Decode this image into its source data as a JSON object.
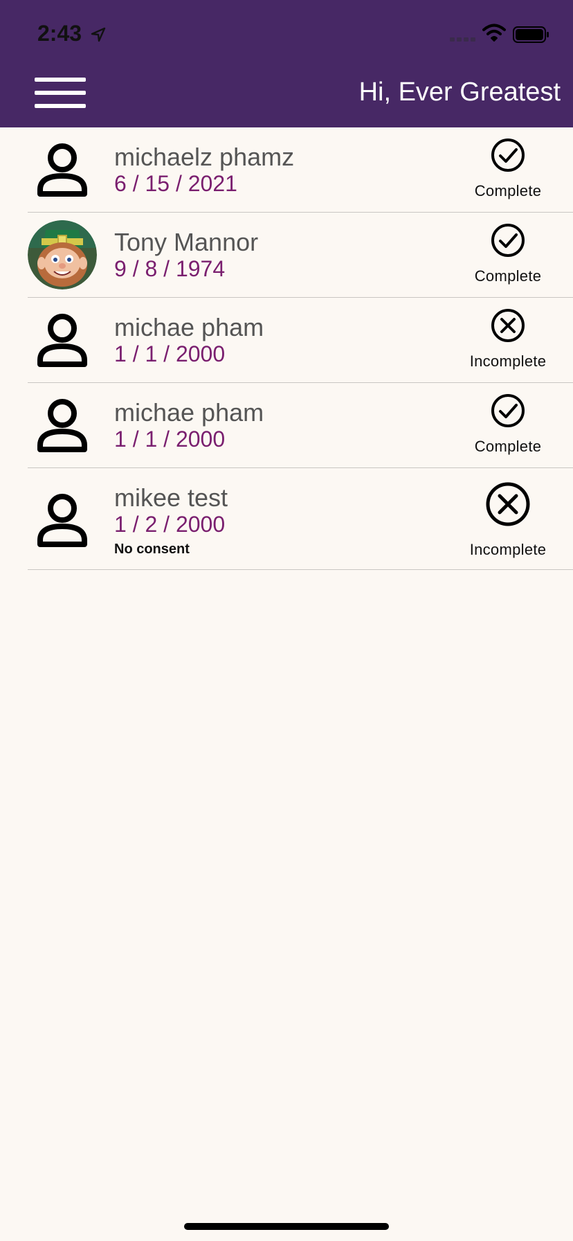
{
  "status_bar": {
    "time": "2:43",
    "icons": [
      "location-arrow-icon",
      "signal-icon",
      "wifi-icon",
      "battery-icon"
    ]
  },
  "header": {
    "greeting": "Hi, Ever Greatest",
    "menu_icon": "hamburger-menu-icon",
    "background": "#472865"
  },
  "patients": [
    {
      "name": "michaelz phamz",
      "dob": "6 / 15 / 2021",
      "avatar": "person-icon",
      "status": "Complete",
      "status_icon": "check-circle-icon",
      "note": ""
    },
    {
      "name": "Tony Mannor",
      "dob": "9 / 8 / 1974",
      "avatar": "photo",
      "status": "Complete",
      "status_icon": "check-circle-icon",
      "note": ""
    },
    {
      "name": "michae pham",
      "dob": "1 / 1 / 2000",
      "avatar": "person-icon",
      "status": "Incomplete",
      "status_icon": "x-circle-icon",
      "note": ""
    },
    {
      "name": "michae pham",
      "dob": "1 / 1 / 2000",
      "avatar": "person-icon",
      "status": "Complete",
      "status_icon": "check-circle-icon",
      "note": ""
    },
    {
      "name": "mikee test",
      "dob": "1 / 2 / 2000",
      "avatar": "person-icon",
      "status": "Incomplete",
      "status_icon": "x-circle-icon",
      "note": "No consent"
    }
  ],
  "colors": {
    "header": "#472865",
    "background": "#fcf8f3",
    "name": "#555555",
    "dob": "#7a1f6f",
    "divider": "#c9c6c2"
  }
}
